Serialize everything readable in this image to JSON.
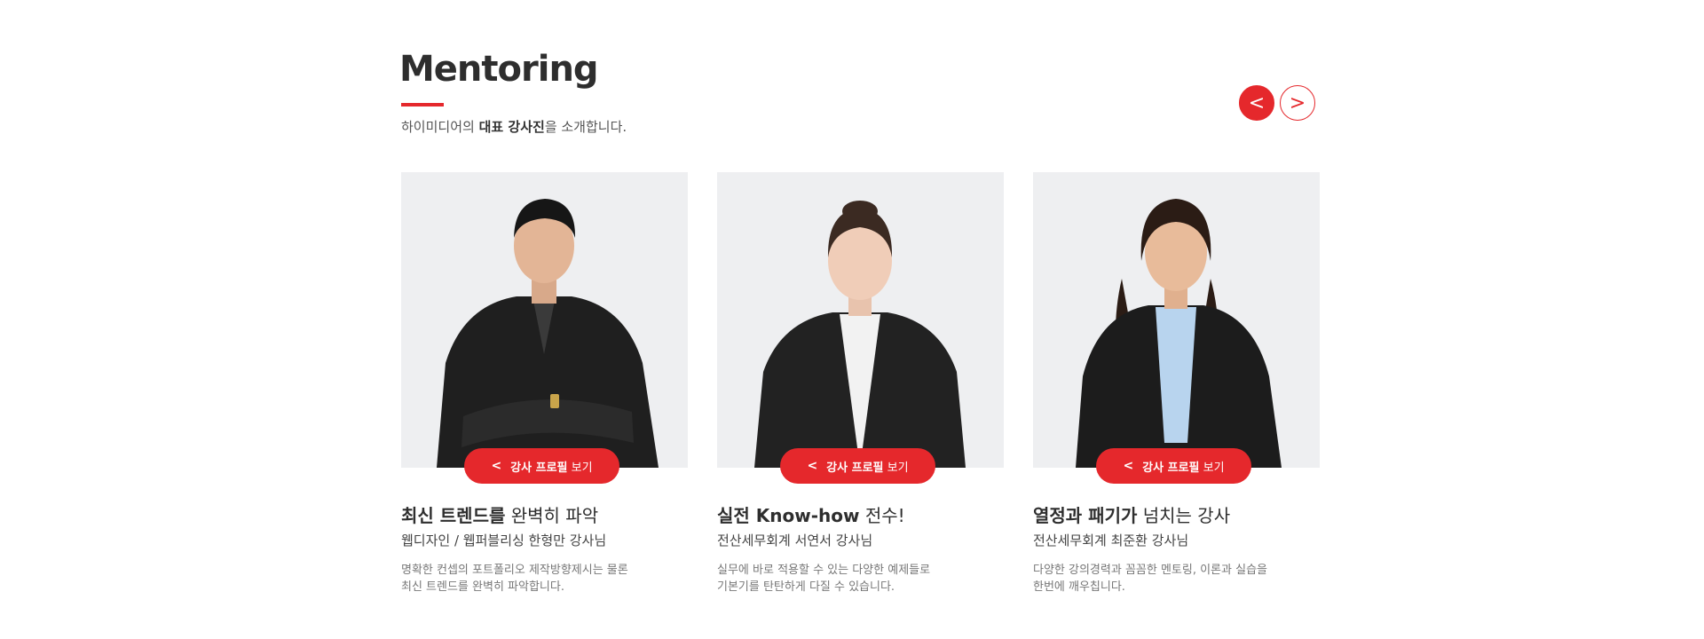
{
  "header": {
    "title": "Mentoring",
    "subtitle_prefix": "하이미디어의 ",
    "subtitle_bold": "대표 강사진",
    "subtitle_suffix": "을 소개합니다."
  },
  "nav": {
    "prev_label": "<",
    "next_label": ">"
  },
  "colors": {
    "accent": "#e5282c",
    "photo_bg": "#eeeff1"
  },
  "cards": [
    {
      "button_chevron": "<",
      "button_bold": "강사 프로필",
      "button_text": " 보기",
      "headline_bold": "최신 트렌드를",
      "headline_text": " 완벽히 파악",
      "name": "웹디자인 / 웹퍼블리싱 한형만 강사님",
      "desc_line1": "명확한 컨셉의 포트폴리오 제작방향제시는 물론",
      "desc_line2": "최신 트렌드를 완벽히 파악합니다."
    },
    {
      "button_chevron": "<",
      "button_bold": "강사 프로필",
      "button_text": " 보기",
      "headline_bold": "실전 Know-how",
      "headline_text": " 전수!",
      "name": "전산세무회계 서연서 강사님",
      "desc_line1": "실무에 바로 적용할 수 있는 다양한 예제들로",
      "desc_line2": "기본기를 탄탄하게 다질 수 있습니다."
    },
    {
      "button_chevron": "<",
      "button_bold": "강사 프로필",
      "button_text": " 보기",
      "headline_bold": "열정과 패기가",
      "headline_text": " 넘치는 강사",
      "name": "전산세무회계 최준환 강사님",
      "desc_line1": "다양한 강의경력과 꼼꼼한 멘토링, 이론과 실습을",
      "desc_line2": "한번에 깨우칩니다."
    }
  ]
}
